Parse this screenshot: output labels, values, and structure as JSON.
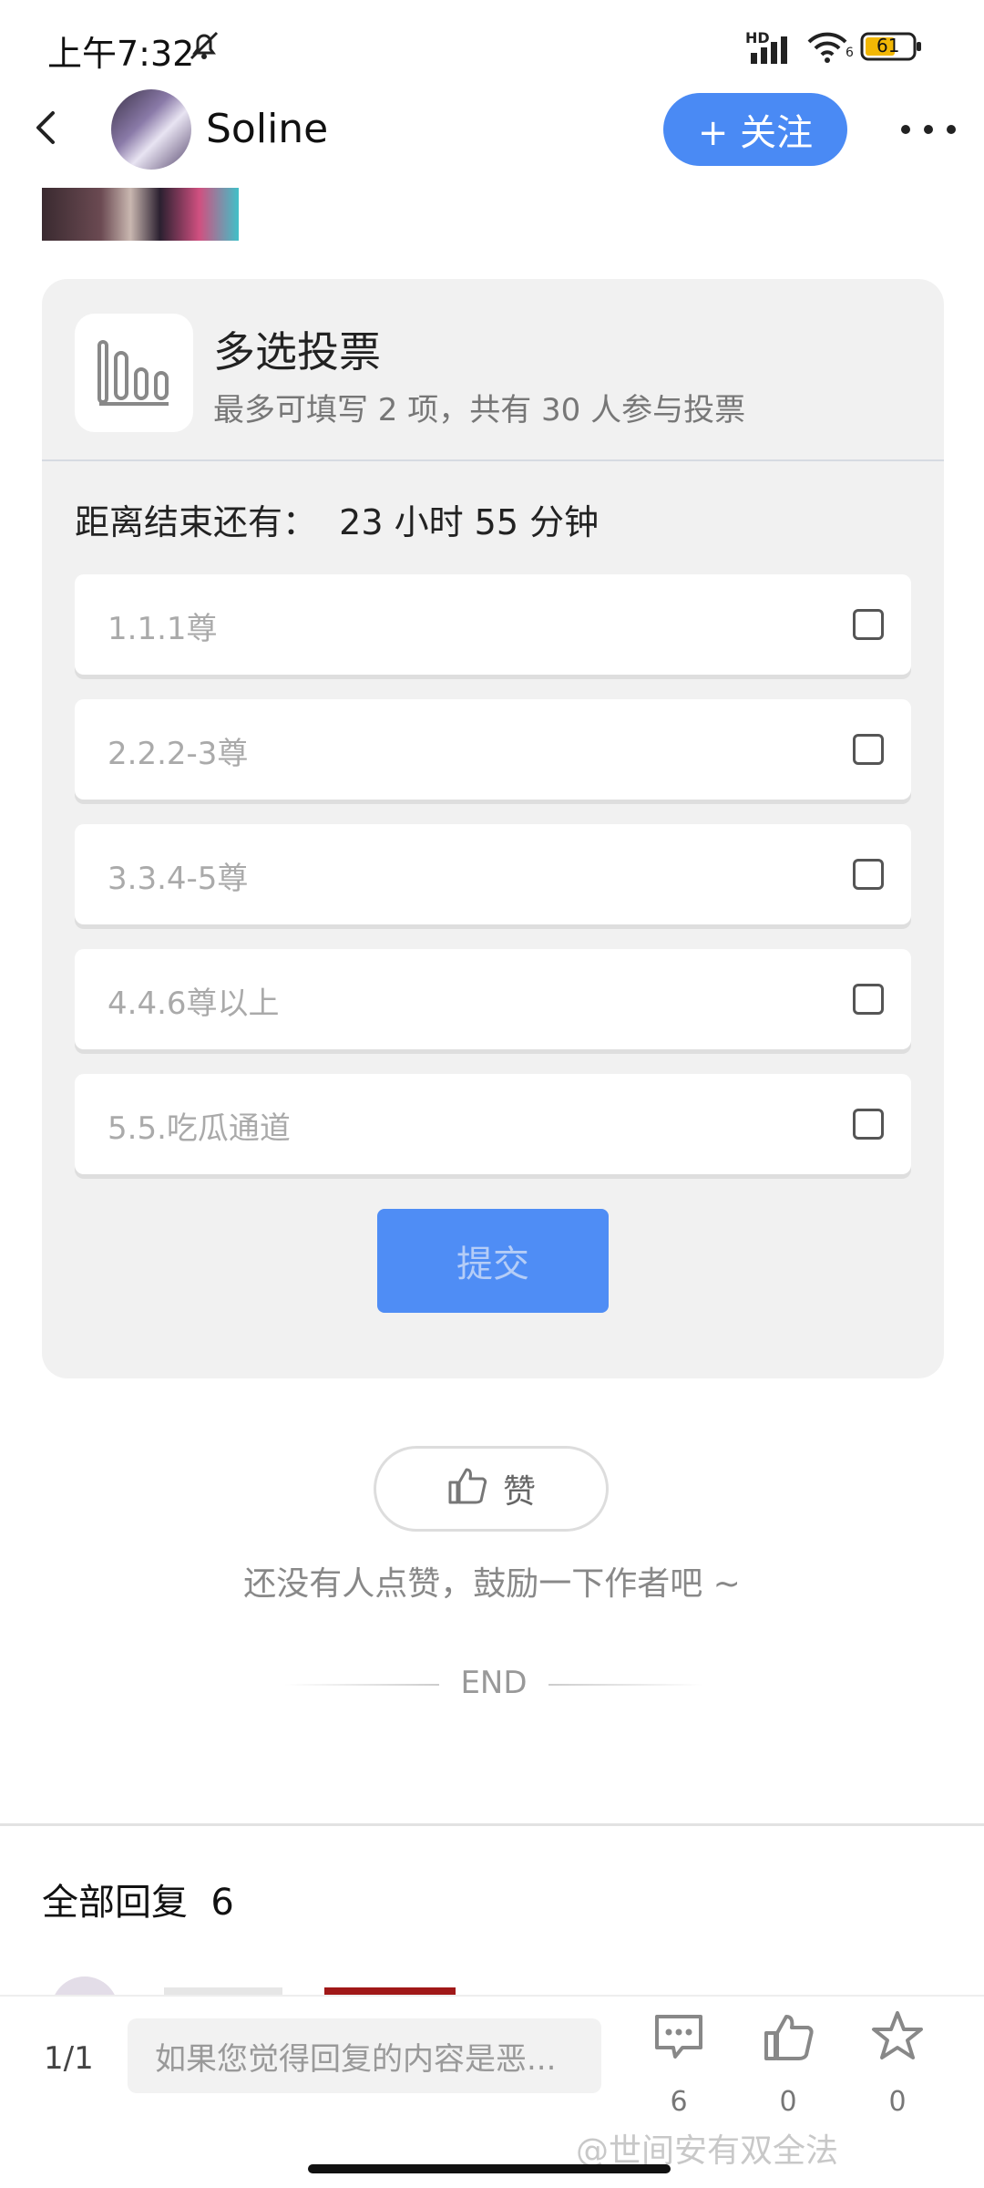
{
  "status_bar": {
    "time": "上午7:32",
    "network": "HD",
    "wifi_sub": "6",
    "battery": "61"
  },
  "nav": {
    "username": "Soline",
    "follow_label": "+ 关注"
  },
  "poll": {
    "title": "多选投票",
    "subtitle": "最多可填写 2 项，共有 30 人参与投票",
    "countdown": "距离结束还有：  23 小时 55 分钟",
    "options": [
      {
        "label": "1.1.1尊",
        "checked": false
      },
      {
        "label": "2.2.2-3尊",
        "checked": false
      },
      {
        "label": "3.3.4-5尊",
        "checked": false
      },
      {
        "label": "4.4.6尊以上",
        "checked": false
      },
      {
        "label": "5.5.吃瓜通道",
        "checked": false
      }
    ],
    "submit_label": "提交"
  },
  "like": {
    "label": "赞",
    "hint": "还没有人点赞，鼓励一下作者吧 ~"
  },
  "end_label": "END",
  "replies": {
    "title": "全部回复  6"
  },
  "bottom_bar": {
    "page_indicator": "1/1",
    "reply_placeholder": "如果您觉得回复的内容是恶...",
    "comment_count": "6",
    "like_count": "0",
    "star_count": "0"
  },
  "watermark": "@世间安有双全法",
  "colors": {
    "accent": "#4a8af4",
    "card_bg": "#f1f1f1"
  },
  "icons": [
    "back-icon",
    "bell-off-icon",
    "signal-icon",
    "wifi-icon",
    "battery-icon",
    "more-icon",
    "bar-chart-icon",
    "thumbs-up-icon",
    "comment-icon",
    "star-icon"
  ]
}
